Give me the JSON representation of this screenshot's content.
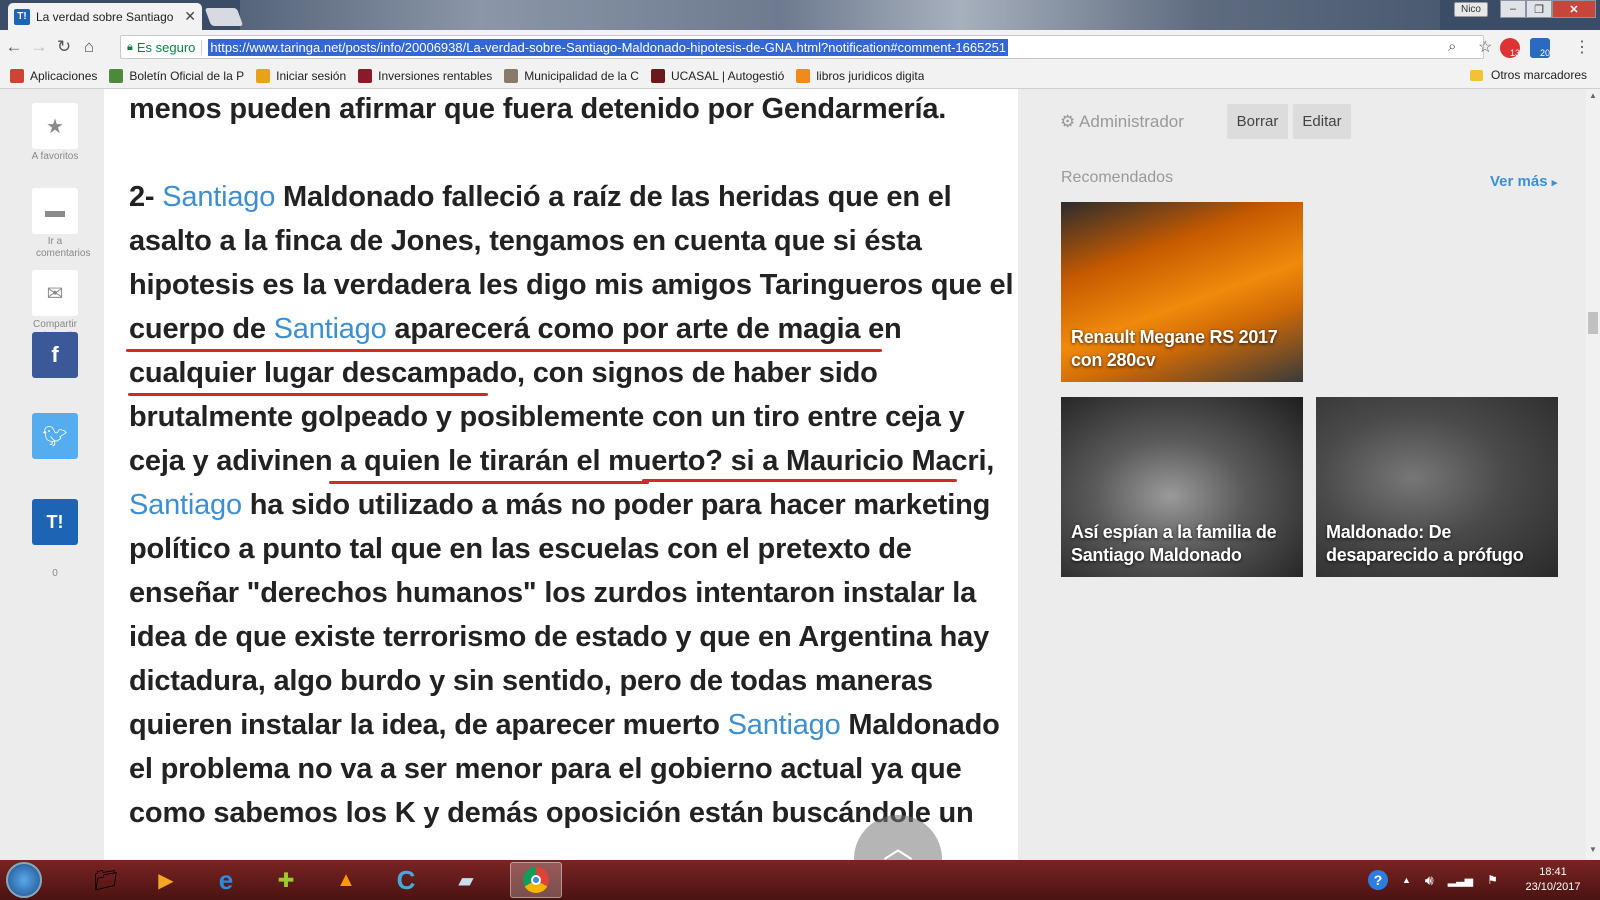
{
  "browser": {
    "tab_title": "La verdad sobre Santiago",
    "tab_favicon": "T!",
    "win_user": "Nico",
    "secure_label": "Es seguro",
    "url": "https://www.taringa.net/posts/info/20006938/La-verdad-sobre-Santiago-Maldonado-hipotesis-de-GNA.html?notification#comment-1665251",
    "ext1_badge": "13",
    "ext2_badge": "20"
  },
  "bookmarks": [
    {
      "label": "Aplicaciones",
      "color": "#c43"
    },
    {
      "label": "Boletín Oficial de la P",
      "color": "#4a8a3a"
    },
    {
      "label": "Iniciar sesión",
      "color": "#e8a21a"
    },
    {
      "label": "Inversiones rentables",
      "color": "#8a1a2a"
    },
    {
      "label": "Municipalidad de la C",
      "color": "#8a7a6a"
    },
    {
      "label": "UCASAL | Autogestió",
      "color": "#6a1a1a"
    },
    {
      "label": "libros juridicos digita",
      "color": "#f08a1a"
    }
  ],
  "bookmarks_other": "Otros marcadores",
  "sidebar": {
    "fav_label": "A favoritos",
    "comments_label": "Ir a comentarios",
    "share_mail_label": "Compartir vía mail",
    "fb_icon": "f",
    "taringa_icon": "T!",
    "taringa_count": "0"
  },
  "article": {
    "lines": [
      {
        "parts": [
          {
            "t": "menos pueden afirmar que fuera detenido por Gendarmería."
          }
        ]
      },
      {
        "parts": [
          {
            "t": "2- "
          },
          {
            "t": "Santiago",
            "link": true
          },
          {
            "t": " Maldonado falleció a raíz de las heridas que en el"
          }
        ]
      },
      {
        "parts": [
          {
            "t": "asalto a la finca de Jones, tengamos en cuenta que si ésta"
          }
        ]
      },
      {
        "parts": [
          {
            "t": "hipotesis es la verdadera les digo mis amigos Taringueros que el"
          }
        ]
      },
      {
        "parts": [
          {
            "t": "cuerpo de "
          },
          {
            "t": "Santiago",
            "link": true
          },
          {
            "t": " aparecerá como por arte de magia en"
          }
        ]
      },
      {
        "parts": [
          {
            "t": "cualquier lugar descampado"
          },
          {
            "t": ", con signos de haber sido"
          }
        ]
      },
      {
        "parts": [
          {
            "t": "brutalmente golpeado y posiblemente con un tiro entre ceja y"
          }
        ]
      },
      {
        "parts": [
          {
            "t": "ceja y adivinen a quien le tirarán el muerto? si a Mauricio Macri,"
          }
        ]
      },
      {
        "parts": [
          {
            "t": "Santiago",
            "link": true
          },
          {
            "t": " ha sido utilizado a más no poder para hacer marketing"
          }
        ]
      },
      {
        "parts": [
          {
            "t": "político a punto tal que en las escuelas con el pretexto de"
          }
        ]
      },
      {
        "parts": [
          {
            "t": "enseñar \"derechos humanos\" los zurdos intentaron instalar la"
          }
        ]
      },
      {
        "parts": [
          {
            "t": "idea de que existe terrorismo de estado y que en Argentina hay"
          }
        ]
      },
      {
        "parts": [
          {
            "t": "dictadura, algo burdo y sin sentido, pero de todas maneras"
          }
        ]
      },
      {
        "parts": [
          {
            "t": "quieren instalar la idea, de aparecer muerto "
          },
          {
            "t": "Santiago",
            "link": true
          },
          {
            "t": " Maldonado"
          }
        ]
      },
      {
        "parts": [
          {
            "t": "el problema no va a ser menor para el gobierno actual ya que"
          }
        ]
      },
      {
        "parts": [
          {
            "t": "como sabemos los K y demás oposición están buscándole un"
          }
        ]
      }
    ],
    "scroll_up_icon": "chevron-up"
  },
  "right": {
    "admin_label": "Administrador",
    "borrar": "Borrar",
    "editar": "Editar",
    "recommended_title": "Recomendados",
    "ver_mas": "Ver más",
    "cards": [
      "Renault Megane RS 2017 con 280cv",
      "Así espían a la familia de Santiago Maldonado",
      "Maldonado: De desaparecido a prófugo"
    ]
  },
  "taskbar": {
    "time": "18:41",
    "date": "23/10/2017"
  },
  "colors": {
    "link": "#3d8fd1",
    "underline": "#d02a2a",
    "taringa_blue": "#1d64b4"
  }
}
